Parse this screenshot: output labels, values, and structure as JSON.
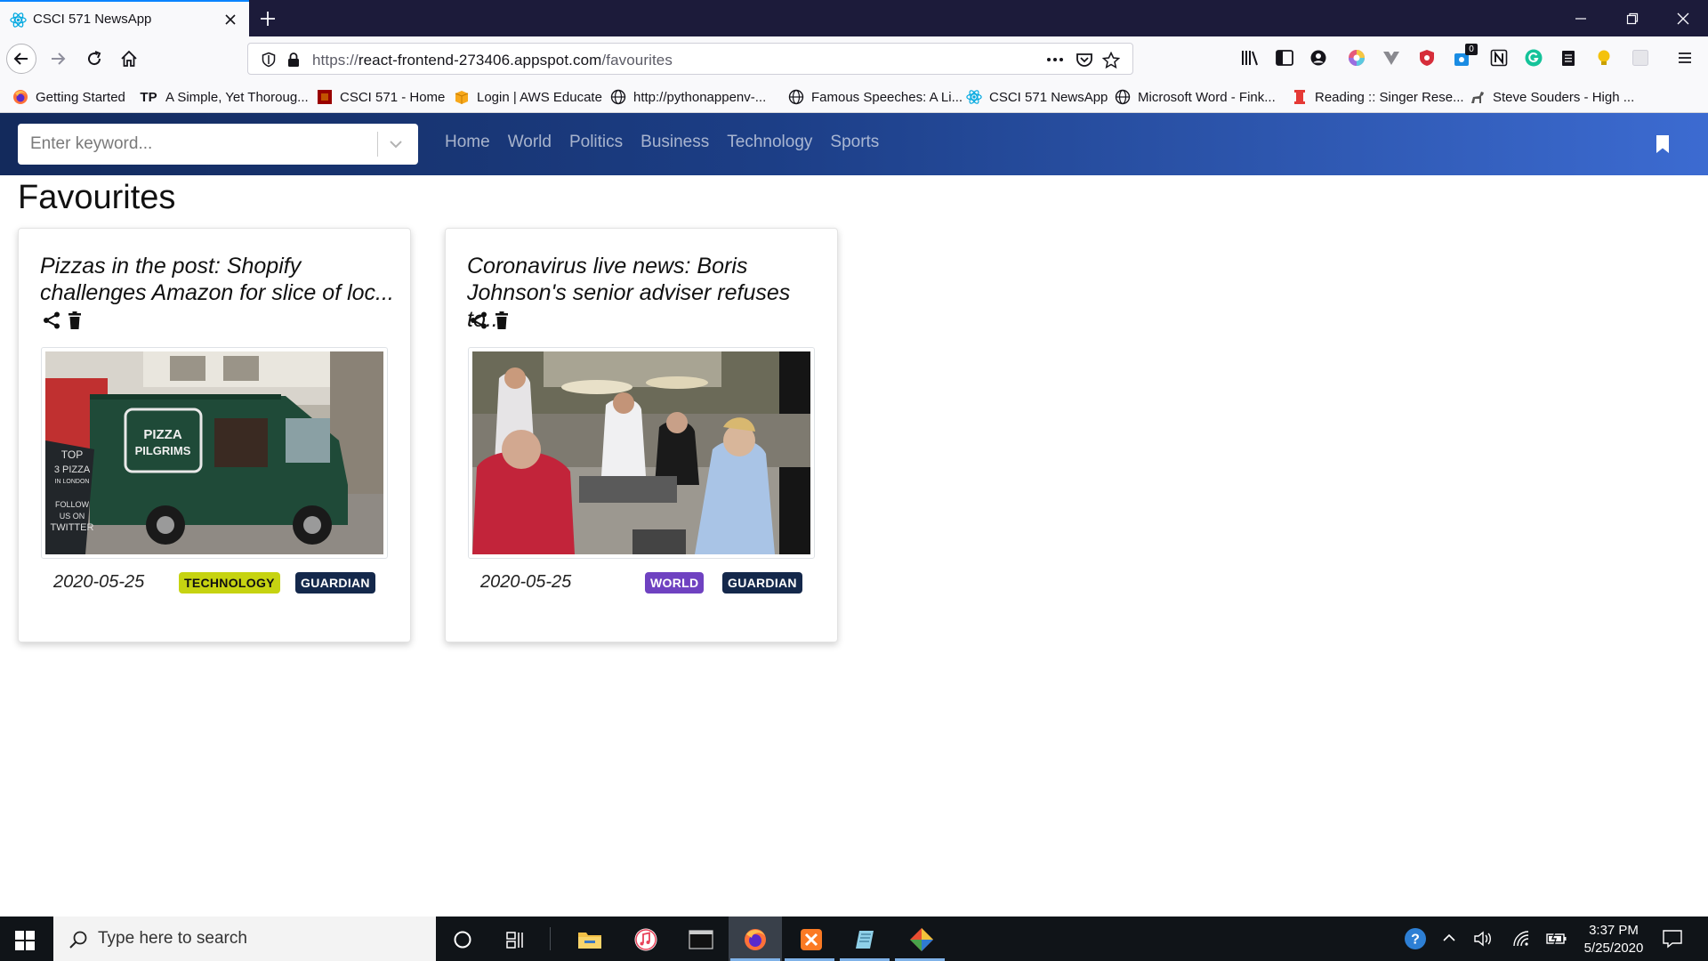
{
  "browser": {
    "tab_title": "CSCI 571 NewsApp",
    "url_prefix": "https://",
    "url_host": "react-frontend-273406.appspot.com",
    "url_path": "/favourites",
    "extension_badge": "0",
    "bookmarks": [
      {
        "label": "Getting Started",
        "icon": "firefox-icon"
      },
      {
        "label": "A Simple, Yet Thoroug...",
        "icon": "tp-icon",
        "icon_text": "TP"
      },
      {
        "label": "CSCI 571 - Home",
        "icon": "usc-icon"
      },
      {
        "label": "Login | AWS Educate",
        "icon": "aws-icon"
      },
      {
        "label": "http://pythonappenv-...",
        "icon": "globe-icon"
      },
      {
        "label": "Famous Speeches: A Li...",
        "icon": "globe-icon"
      },
      {
        "label": "CSCI 571 NewsApp",
        "icon": "react-icon"
      },
      {
        "label": "Microsoft Word - Fink...",
        "icon": "globe-icon"
      },
      {
        "label": "Reading :: Singer Rese...",
        "icon": "reading-icon"
      },
      {
        "label": "Steve Souders - High ...",
        "icon": "dog-icon"
      }
    ]
  },
  "app": {
    "search_placeholder": "Enter keyword...",
    "nav": [
      "Home",
      "World",
      "Politics",
      "Business",
      "Technology",
      "Sports"
    ],
    "page_title": "Favourites",
    "cards": [
      {
        "title": "Pizzas in the post: Shopify challenges Amazon for slice of loc...",
        "date": "2020-05-25",
        "section": "TECHNOLOGY",
        "source": "GUARDIAN",
        "section_color": "#c6d311",
        "image": "green pizza van photo",
        "image_text": [
          "PIZZA",
          "PILGRIMS",
          "TOP",
          "3 PIZZA",
          "IN LONDON",
          "FOLLOW",
          "US ON",
          "TWITTER"
        ]
      },
      {
        "title": "Coronavirus live news: Boris Johnson's senior adviser refuses to...",
        "date": "2020-05-25",
        "section": "WORLD",
        "source": "GUARDIAN",
        "section_color": "#6f42c1",
        "image": "cafe terrace photo with masked waiters"
      }
    ]
  },
  "taskbar": {
    "search_placeholder": "Type here to search",
    "time": "3:37 PM",
    "date": "5/25/2020"
  },
  "colors": {
    "header_start": "#132a5c",
    "header_end": "#3c6bd1",
    "badge_guardian": "#14284b",
    "tab_accent": "#0a84ff"
  }
}
